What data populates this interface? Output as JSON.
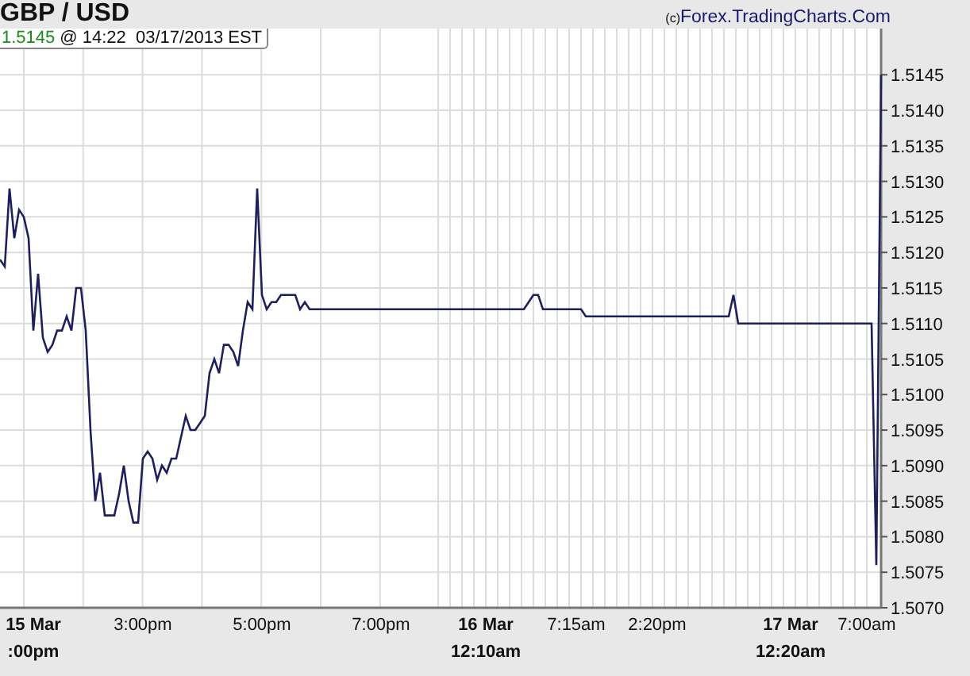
{
  "header": {
    "copyright_mark": "(c)",
    "source": "Forex.TradingCharts.Com"
  },
  "quote": {
    "price": "1.5145",
    "time": "@ 14:22  03/17/2013 EST"
  },
  "chart": {
    "chart_data": {
      "type": "line",
      "title": "GBP / USD",
      "grid": true,
      "categories": [
        null,
        null,
        null,
        null,
        null,
        null,
        null,
        "15 Mar\n:00pm",
        null,
        null,
        null,
        null,
        null,
        null,
        null,
        null,
        null,
        null,
        null,
        null,
        null,
        null,
        null,
        null,
        null,
        null,
        null,
        null,
        null,
        null,
        "3:00pm",
        null,
        null,
        null,
        null,
        null,
        null,
        null,
        null,
        null,
        null,
        null,
        null,
        null,
        null,
        null,
        null,
        null,
        null,
        null,
        null,
        null,
        null,
        null,
        null,
        "5:00pm",
        null,
        null,
        null,
        null,
        null,
        null,
        null,
        null,
        null,
        null,
        null,
        null,
        null,
        null,
        null,
        null,
        null,
        null,
        null,
        null,
        null,
        null,
        null,
        null,
        "7:00pm",
        null,
        null,
        null,
        null,
        null,
        null,
        null,
        null,
        null,
        null,
        null,
        null,
        null,
        null,
        null,
        null,
        null,
        null,
        null,
        null,
        null,
        "16 Mar\n12:10am",
        null,
        null,
        null,
        null,
        null,
        null,
        null,
        null,
        null,
        null,
        null,
        null,
        null,
        null,
        null,
        null,
        null,
        null,
        "7:15am",
        null,
        null,
        null,
        null,
        null,
        null,
        null,
        null,
        null,
        null,
        null,
        null,
        null,
        null,
        null,
        null,
        "2:20pm",
        null,
        null,
        null,
        null,
        null,
        null,
        null,
        null,
        null,
        null,
        null,
        null,
        null,
        null,
        null,
        null,
        null,
        null,
        null,
        null,
        null,
        null,
        null,
        null,
        null,
        null,
        null,
        "17 Mar\n12:20am",
        null,
        null,
        null,
        null,
        null,
        null,
        null,
        null,
        null,
        null,
        null,
        null,
        null,
        null,
        null,
        "7:00am",
        null,
        null,
        null
      ],
      "series": [
        {
          "color": "#1f1f5c",
          "values": [
            1.5119,
            1.5118,
            1.5129,
            1.5122,
            1.5126,
            1.5125,
            1.5122,
            1.5109,
            1.5117,
            1.5108,
            1.5106,
            1.5107,
            1.5109,
            1.5109,
            1.5111,
            1.5109,
            1.5115,
            1.5115,
            1.5109,
            1.5095,
            1.5085,
            1.5089,
            1.5083,
            1.5083,
            1.5083,
            1.5086,
            1.509,
            1.5085,
            1.5082,
            1.5082,
            1.5091,
            1.5092,
            1.5091,
            1.5088,
            1.509,
            1.5089,
            1.5091,
            1.5091,
            1.5094,
            1.5097,
            1.5095,
            1.5095,
            1.5096,
            1.5097,
            1.5103,
            1.5105,
            1.5103,
            1.5107,
            1.5107,
            1.5106,
            1.5104,
            1.5109,
            1.5113,
            1.5112,
            1.5129,
            1.5114,
            1.5112,
            1.5113,
            1.5113,
            1.5114,
            1.5114,
            1.5114,
            1.5114,
            1.5112,
            1.5113,
            1.5112,
            1.5112,
            1.5112,
            1.5112,
            1.5112,
            1.5112,
            1.5112,
            1.5112,
            1.5112,
            1.5112,
            1.5112,
            1.5112,
            1.5112,
            1.5112,
            1.5112,
            1.5112,
            1.5112,
            1.5112,
            1.5112,
            1.5112,
            1.5112,
            1.5112,
            1.5112,
            1.5112,
            1.5112,
            1.5112,
            1.5112,
            1.5112,
            1.5112,
            1.5112,
            1.5112,
            1.5112,
            1.5112,
            1.5112,
            1.5112,
            1.5112,
            1.5112,
            1.5112,
            1.5112,
            1.5112,
            1.5112,
            1.5112,
            1.5112,
            1.5112,
            1.5112,
            1.5112,
            1.5113,
            1.5114,
            1.5114,
            1.5112,
            1.5112,
            1.5112,
            1.5112,
            1.5112,
            1.5112,
            1.5112,
            1.5112,
            1.5112,
            1.5111,
            1.5111,
            1.5111,
            1.5111,
            1.5111,
            1.5111,
            1.5111,
            1.5111,
            1.5111,
            1.5111,
            1.5111,
            1.5111,
            1.5111,
            1.5111,
            1.5111,
            1.5111,
            1.5111,
            1.5111,
            1.5111,
            1.5111,
            1.5111,
            1.5111,
            1.5111,
            1.5111,
            1.5111,
            1.5111,
            1.5111,
            1.5111,
            1.5111,
            1.5111,
            1.5111,
            1.5114,
            1.511,
            1.511,
            1.511,
            1.511,
            1.511,
            1.511,
            1.511,
            1.511,
            1.511,
            1.511,
            1.511,
            1.511,
            1.511,
            1.511,
            1.511,
            1.511,
            1.511,
            1.511,
            1.511,
            1.511,
            1.511,
            1.511,
            1.511,
            1.511,
            1.511,
            1.511,
            1.511,
            1.511,
            1.511,
            1.5076,
            1.5145
          ]
        }
      ],
      "ylim": [
        1.507,
        1.51515
      ],
      "yticks": [
        {
          "value": 1.507,
          "label": "1.5070"
        },
        {
          "value": 1.5075,
          "label": "1.5075"
        },
        {
          "value": 1.508,
          "label": "1.5080"
        },
        {
          "value": 1.5085,
          "label": "1.5085"
        },
        {
          "value": 1.509,
          "label": "1.5090"
        },
        {
          "value": 1.5095,
          "label": "1.5095"
        },
        {
          "value": 1.51,
          "label": "1.5100"
        },
        {
          "value": 1.5105,
          "label": "1.5105"
        },
        {
          "value": 1.511,
          "label": "1.5110"
        },
        {
          "value": 1.5115,
          "label": "1.5115"
        },
        {
          "value": 1.512,
          "label": "1.5120"
        },
        {
          "value": 1.5125,
          "label": "1.5125"
        },
        {
          "value": 1.513,
          "label": "1.5130"
        },
        {
          "value": 1.5135,
          "label": "1.5135"
        },
        {
          "value": 1.514,
          "label": "1.5140"
        },
        {
          "value": 1.5145,
          "label": "1.5145"
        }
      ]
    }
  }
}
